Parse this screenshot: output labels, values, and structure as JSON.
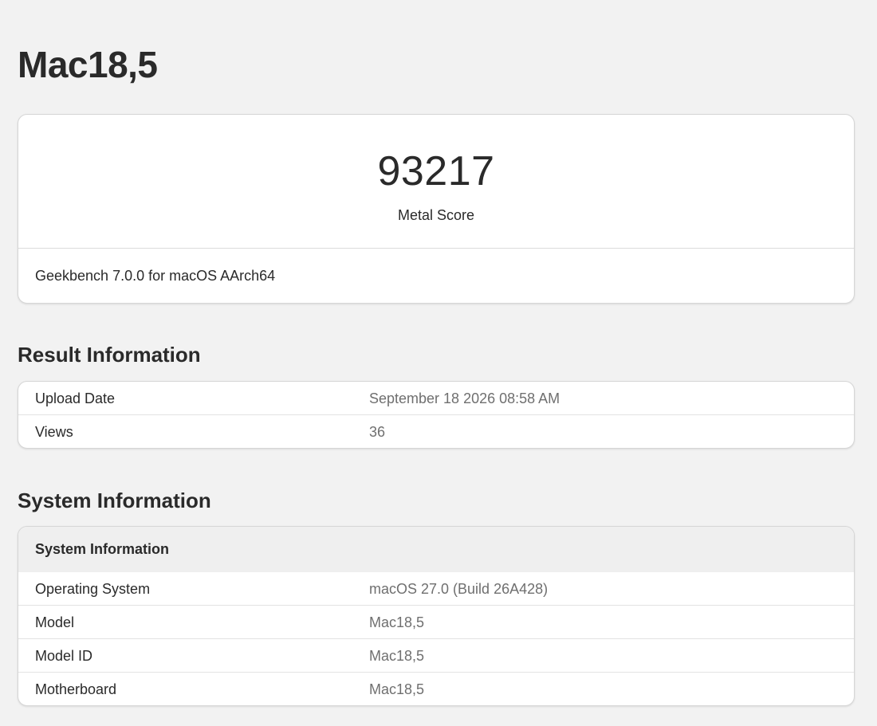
{
  "page": {
    "title": "Mac18,5"
  },
  "score": {
    "value": "93217",
    "label": "Metal Score",
    "version": "Geekbench 7.0.0 for macOS AArch64"
  },
  "result_information": {
    "title": "Result Information",
    "rows": [
      {
        "key": "Upload Date",
        "value": "September 18 2026 08:58 AM"
      },
      {
        "key": "Views",
        "value": "36"
      }
    ]
  },
  "system_information": {
    "title": "System Information",
    "table_header": "System Information",
    "rows": [
      {
        "key": "Operating System",
        "value": "macOS 27.0 (Build 26A428)"
      },
      {
        "key": "Model",
        "value": "Mac18,5"
      },
      {
        "key": "Model ID",
        "value": "Mac18,5"
      },
      {
        "key": "Motherboard",
        "value": "Mac18,5"
      }
    ]
  },
  "colors": {
    "background": "#f2f2f2",
    "card": "#ffffff",
    "text": "#2a2a2a",
    "muted_text": "#6f6f6f",
    "table_header_bg": "#efefef"
  }
}
